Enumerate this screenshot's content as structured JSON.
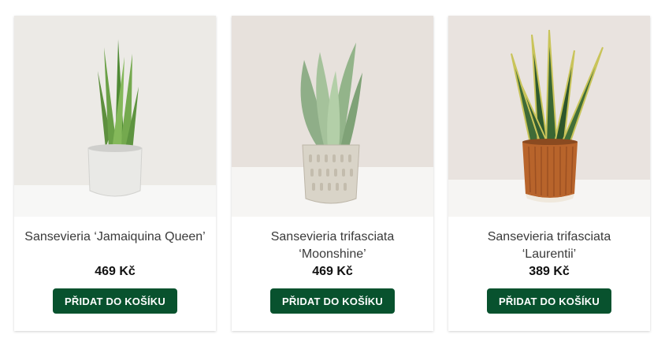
{
  "products": [
    {
      "name_line1": "Sansevieria ‘Jamaiquina Queen’",
      "name_line2": "",
      "price": "469 Kč",
      "button_label": "PŘIDAT DO KOŠÍKU",
      "pot_color": "#e9e9e6",
      "bg_color": "#eceae6"
    },
    {
      "name_line1": "Sansevieria trifasciata",
      "name_line2": "‘Moonshine’",
      "price": "469 Kč",
      "button_label": "PŘIDAT DO KOŠÍKU",
      "pot_color": "#d9d4c8",
      "bg_color": "#e7e1dc"
    },
    {
      "name_line1": "Sansevieria trifasciata",
      "name_line2": "‘Laurentii’",
      "price": "389 Kč",
      "button_label": "PŘIDAT DO KOŠÍKU",
      "pot_color": "#b8642b",
      "bg_color": "#e9e3df"
    }
  ],
  "colors": {
    "button_bg": "#08522e",
    "button_text": "#ffffff",
    "price_text": "#111111",
    "name_text": "#3a3a3a"
  }
}
